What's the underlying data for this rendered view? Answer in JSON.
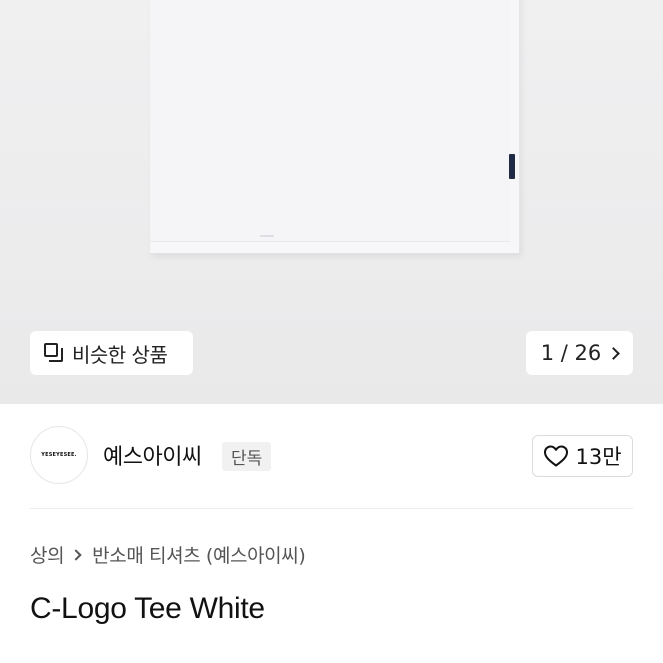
{
  "gallery": {
    "similar_label": "비슷한 상품",
    "counter": "1 / 26"
  },
  "brand": {
    "logo_text": "YESEYESEE.",
    "name": "예스아이씨",
    "badge": "단독",
    "likes": "13만"
  },
  "breadcrumb": {
    "items": [
      "상의",
      "반소매 티셔츠 (예스아이씨)"
    ]
  },
  "product": {
    "title": "C-Logo Tee White"
  },
  "icons": {
    "similar": "similar-products-icon",
    "next": "chevron-right-icon",
    "heart": "heart-icon"
  },
  "colors": {
    "hero_bg": "#ececed",
    "text": "#111111",
    "muted": "#555555"
  }
}
